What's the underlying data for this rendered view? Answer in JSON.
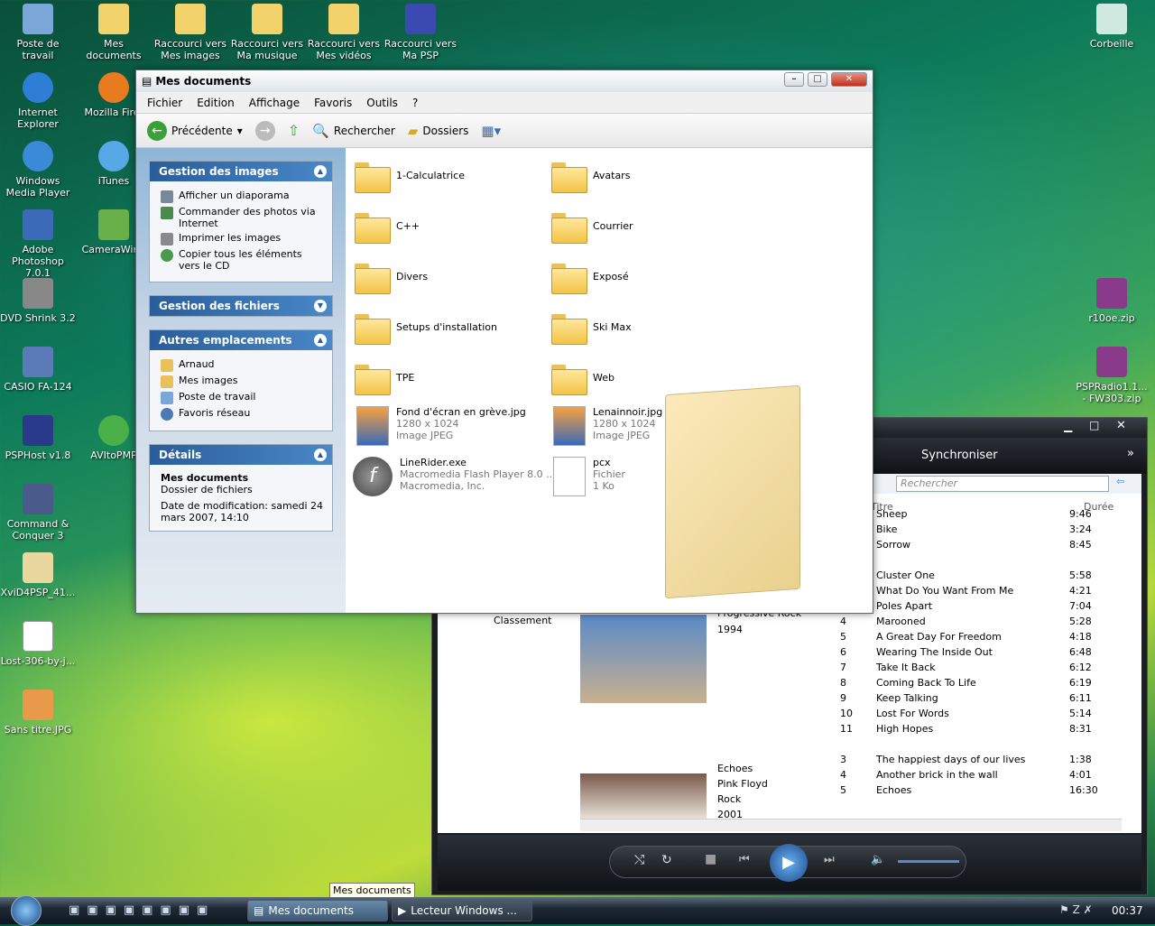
{
  "desktop": {
    "icons": [
      "Poste de travail",
      "Mes documents",
      "Raccourci vers Mes images",
      "Raccourci vers Ma musique",
      "Raccourci vers Mes vidéos",
      "Raccourci vers Ma PSP",
      "Corbeille",
      "Internet Explorer",
      "Mozilla Firef",
      "Windows Media Player",
      "iTunes",
      "Adobe Photoshop 7.0.1",
      "CameraWind",
      "DVD Shrink 3.2",
      "CASIO FA-124",
      "PSPHost v1.8",
      "AVItoPMP",
      "Command & Conquer 3",
      "XviD4PSP_41...",
      "Lost-306-by-j...",
      "Sans titre.JPG",
      "r10oe.zip",
      "PSPRadio1.1... - FW303.zip"
    ]
  },
  "explorer": {
    "title": "Mes documents",
    "menu": [
      "Fichier",
      "Edition",
      "Affichage",
      "Favoris",
      "Outils",
      "?"
    ],
    "toolbar": {
      "back": "Précédente",
      "search": "Rechercher",
      "folders": "Dossiers"
    },
    "panels": {
      "images": {
        "title": "Gestion des images",
        "items": [
          "Afficher un diaporama",
          "Commander des photos via Internet",
          "Imprimer les images",
          "Copier tous les éléments vers le CD"
        ]
      },
      "files": {
        "title": "Gestion des fichiers"
      },
      "other": {
        "title": "Autres emplacements",
        "items": [
          "Arnaud",
          "Mes images",
          "Poste de travail",
          "Favoris réseau"
        ]
      },
      "details": {
        "title": "Détails",
        "name": "Mes documents",
        "type": "Dossier de fichiers",
        "date": "Date de modification: samedi 24 mars 2007, 14:10"
      }
    },
    "items": [
      {
        "name": "1-Calculatrice"
      },
      {
        "name": "Avatars"
      },
      {
        "name": "C++"
      },
      {
        "name": "Courrier"
      },
      {
        "name": "Divers"
      },
      {
        "name": "Exposé"
      },
      {
        "name": "Setups d'installation"
      },
      {
        "name": "Ski Max"
      },
      {
        "name": "TPE"
      },
      {
        "name": "Web"
      },
      {
        "name": "Fond d'écran en grève.jpg",
        "l2": "1280 x 1024",
        "l3": "Image JPEG"
      },
      {
        "name": "Lenainnoir.jpg",
        "l2": "1280 x 1024",
        "l3": "Image JPEG"
      },
      {
        "name": "LineRider.exe",
        "l2": "Macromedia Flash Player 8.0 ...",
        "l3": "Macromedia, Inc."
      },
      {
        "name": "pcx",
        "l2": "Fichier",
        "l3": "1 Ko"
      }
    ]
  },
  "wmp": {
    "tab": "Synchroniser",
    "search_placeholder": "Rechercher",
    "col_title": "Titre",
    "col_duration": "Durée",
    "classement": "Classement",
    "album1": {
      "genre": "Progressive Rock",
      "year": "1994"
    },
    "album2": {
      "title": "Echoes",
      "artist": "Pink Floyd",
      "genre": "Rock",
      "year": "2001"
    },
    "tracks": [
      {
        "n": "",
        "t": "Sheep",
        "d": "9:46"
      },
      {
        "n": "",
        "t": "Bike",
        "d": "3:24"
      },
      {
        "n": "",
        "t": "Sorrow",
        "d": "8:45"
      },
      {
        "n": "",
        "t": "Cluster One",
        "d": "5:58"
      },
      {
        "n": "",
        "t": "What Do You Want From Me",
        "d": "4:21"
      },
      {
        "n": "",
        "t": "Poles Apart",
        "d": "7:04"
      },
      {
        "n": "4",
        "t": "Marooned",
        "d": "5:28"
      },
      {
        "n": "5",
        "t": "A Great Day For Freedom",
        "d": "4:18"
      },
      {
        "n": "6",
        "t": "Wearing The Inside Out",
        "d": "6:48"
      },
      {
        "n": "7",
        "t": "Take It Back",
        "d": "6:12"
      },
      {
        "n": "8",
        "t": "Coming Back To Life",
        "d": "6:19"
      },
      {
        "n": "9",
        "t": "Keep Talking",
        "d": "6:11"
      },
      {
        "n": "10",
        "t": "Lost For Words",
        "d": "5:14"
      },
      {
        "n": "11",
        "t": "High Hopes",
        "d": "8:31"
      },
      {
        "n": "3",
        "t": "The happiest days of our lives",
        "d": "1:38"
      },
      {
        "n": "4",
        "t": "Another brick in the wall",
        "d": "4:01"
      },
      {
        "n": "5",
        "t": "Echoes",
        "d": "16:30"
      }
    ]
  },
  "taskbar": {
    "tasks": [
      "Mes documents",
      "Lecteur Windows ..."
    ],
    "clock": "00:37",
    "tooltip": "Mes documents"
  }
}
